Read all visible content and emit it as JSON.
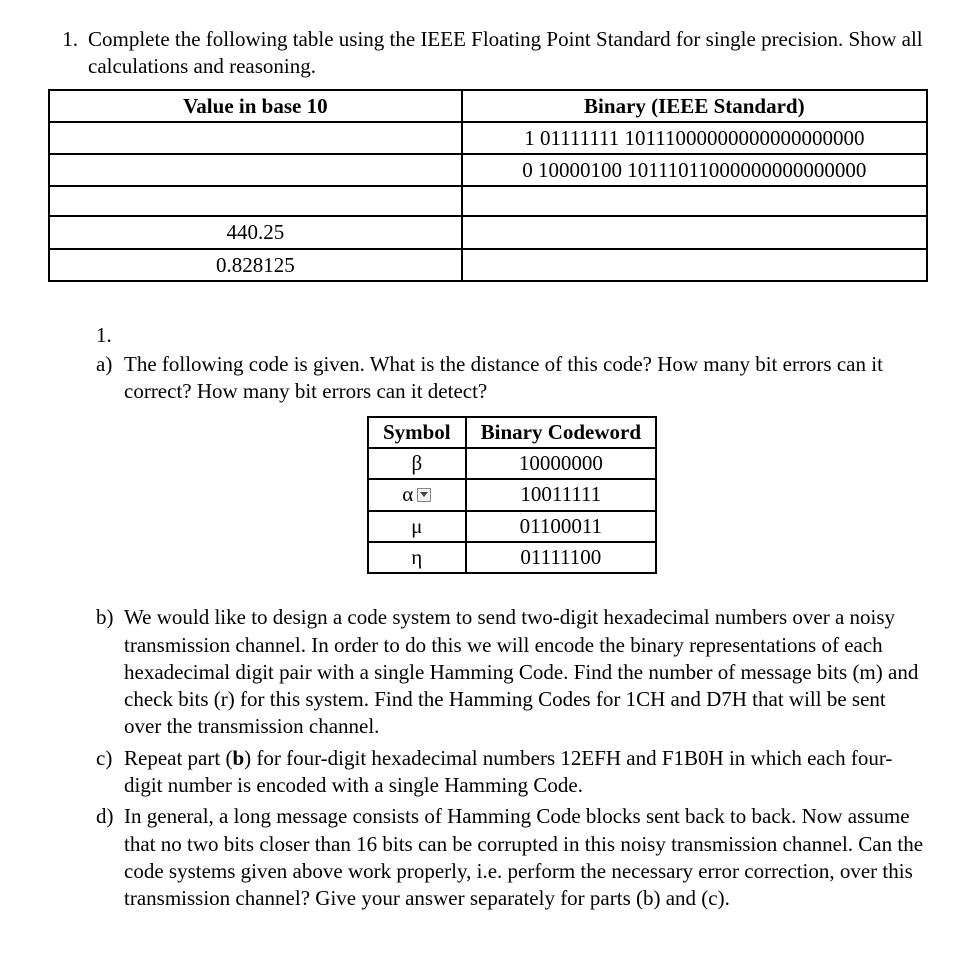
{
  "q1": {
    "number": "1.",
    "prompt": "Complete the following table using the IEEE Floating Point Standard for single precision. Show all calculations and reasoning.",
    "table": {
      "headers": [
        "Value in base 10",
        "Binary (IEEE Standard)"
      ],
      "rows": [
        {
          "base10": "",
          "binary": "1  01111111  10111000000000000000000"
        },
        {
          "base10": "",
          "binary": "0  10000100  10111011000000000000000"
        },
        {
          "base10": "",
          "binary": ""
        },
        {
          "base10": "440.25",
          "binary": ""
        },
        {
          "base10": "0.828125",
          "binary": ""
        }
      ]
    }
  },
  "q2": {
    "number": "1.",
    "parts": {
      "a": {
        "label": "a)",
        "text": "The following code is given. What is the distance of this code? How many bit errors can it correct? How many bit errors can it detect?",
        "table": {
          "headers": [
            "Symbol",
            "Binary Codeword"
          ],
          "rows": [
            {
              "symbol": "β",
              "code": "10000000",
              "hasDropdown": false
            },
            {
              "symbol": "α",
              "code": "10011111",
              "hasDropdown": true
            },
            {
              "symbol": "μ",
              "code": "01100011",
              "hasDropdown": false
            },
            {
              "symbol": "η",
              "code": "01111100",
              "hasDropdown": false
            }
          ]
        }
      },
      "b": {
        "label": "b)",
        "text": "We would like to design a code system to send two-digit hexadecimal numbers over a noisy transmission channel. In order to do this we will encode the binary representations of each hexadecimal digit pair with a single Hamming Code. Find the number of message bits (m) and check bits (r) for this system. Find the Hamming Codes for 1CH and D7H that will be sent over the transmission channel."
      },
      "c": {
        "label": "c)",
        "prefix": "Repeat part (",
        "bold": "b",
        "suffix": ") for four-digit hexadecimal numbers 12EFH and F1B0H in which each four-digit number is encoded with a single Hamming Code."
      },
      "d": {
        "label": "d)",
        "text": "In general, a long message consists of Hamming Code blocks sent back to back. Now assume that no two bits closer than 16 bits can be corrupted in this noisy transmission channel.   Can the code systems given above work properly, i.e. perform the necessary error correction, over this transmission channel? Give your answer separately for parts (b) and (c)."
      }
    }
  }
}
